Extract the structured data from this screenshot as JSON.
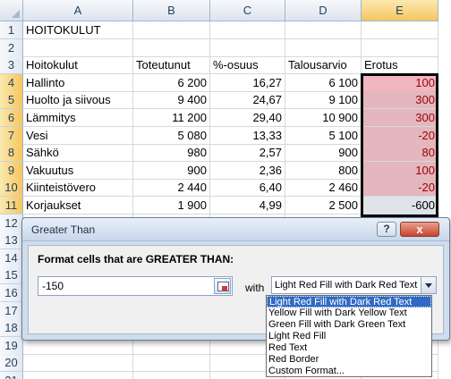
{
  "columns": [
    "A",
    "B",
    "C",
    "D",
    "E"
  ],
  "selected_column": "E",
  "rows": [
    {
      "n": "1",
      "a": "HOITOKULUT",
      "b": "",
      "c": "",
      "d": "",
      "e": "",
      "e_style": "none"
    },
    {
      "n": "2",
      "a": "",
      "b": "",
      "c": "",
      "d": "",
      "e": "",
      "e_style": "none"
    },
    {
      "n": "3",
      "a": "Hoitokulut",
      "b": "Toteutunut",
      "c": "%-osuus",
      "d": "Talousarvio",
      "e": "Erotus",
      "e_style": "none",
      "header": true
    },
    {
      "n": "4",
      "a": "Hallinto",
      "b": "6 200",
      "c": "16,27",
      "d": "6 100",
      "e": "100",
      "e_style": "red-light"
    },
    {
      "n": "5",
      "a": "Huolto ja siivous",
      "b": "9 400",
      "c": "24,67",
      "d": "9 100",
      "e": "300",
      "e_style": "red"
    },
    {
      "n": "6",
      "a": "Lämmitys",
      "b": "11 200",
      "c": "29,40",
      "d": "10 900",
      "e": "300",
      "e_style": "red"
    },
    {
      "n": "7",
      "a": "Vesi",
      "b": "5 080",
      "c": "13,33",
      "d": "5 100",
      "e": "-20",
      "e_style": "red"
    },
    {
      "n": "8",
      "a": "Sähkö",
      "b": "980",
      "c": "2,57",
      "d": "900",
      "e": "80",
      "e_style": "red"
    },
    {
      "n": "9",
      "a": "Vakuutus",
      "b": "900",
      "c": "2,36",
      "d": "800",
      "e": "100",
      "e_style": "red"
    },
    {
      "n": "10",
      "a": "Kiinteistövero",
      "b": "2 440",
      "c": "6,40",
      "d": "2 460",
      "e": "-20",
      "e_style": "red"
    },
    {
      "n": "11",
      "a": "Korjaukset",
      "b": "1 900",
      "c": "4,99",
      "d": "2 500",
      "e": "-600",
      "e_style": "neutral"
    },
    {
      "n": "12",
      "a": "",
      "b": "",
      "c": "",
      "d": "",
      "e": "",
      "e_style": "none"
    },
    {
      "n": "13",
      "a": "",
      "b": "",
      "c": "",
      "d": "",
      "e": "",
      "e_style": "none"
    },
    {
      "n": "14",
      "a": "",
      "b": "",
      "c": "",
      "d": "",
      "e": "",
      "e_style": "none"
    },
    {
      "n": "15",
      "a": "",
      "b": "",
      "c": "",
      "d": "",
      "e": "",
      "e_style": "none"
    },
    {
      "n": "16",
      "a": "",
      "b": "",
      "c": "",
      "d": "",
      "e": "",
      "e_style": "none"
    },
    {
      "n": "17",
      "a": "",
      "b": "",
      "c": "",
      "d": "",
      "e": "",
      "e_style": "none"
    },
    {
      "n": "18",
      "a": "",
      "b": "",
      "c": "",
      "d": "",
      "e": "",
      "e_style": "none"
    },
    {
      "n": "19",
      "a": "",
      "b": "",
      "c": "",
      "d": "",
      "e": "",
      "e_style": "none"
    },
    {
      "n": "20",
      "a": "",
      "b": "",
      "c": "",
      "d": "",
      "e": "",
      "e_style": "none"
    },
    {
      "n": "21",
      "a": "",
      "b": "",
      "c": "",
      "d": "",
      "e": "",
      "e_style": "none"
    }
  ],
  "dialog": {
    "title": "Greater Than",
    "help_label": "?",
    "close_label": "x",
    "prompt": "Format cells that are GREATER THAN:",
    "value": "-150",
    "with_label": "with",
    "selected_format": "Light Red Fill with Dark Red Text",
    "options": [
      "Light Red Fill with Dark Red Text",
      "Yellow Fill with Dark Yellow Text",
      "Green Fill with Dark Green Text",
      "Light Red Fill",
      "Red Text",
      "Red Border",
      "Custom Format..."
    ]
  },
  "colors": {
    "header_bg": "#dde4ee",
    "selected_header": "#f5c65d",
    "conditional_fill": "#e3b7bd",
    "conditional_text": "#9c0006",
    "dropdown_highlight": "#316ac5"
  }
}
